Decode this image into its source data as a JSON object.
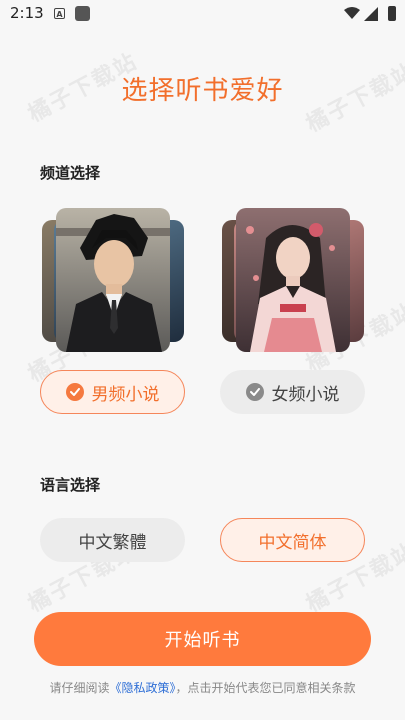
{
  "status": {
    "time": "2:13",
    "a_icon": "A"
  },
  "title": "选择听书爱好",
  "watermark": "橘子下载站",
  "channel": {
    "heading": "频道选择",
    "male": {
      "label": "男频小说",
      "selected": true
    },
    "female": {
      "label": "女频小说",
      "selected": false
    }
  },
  "language": {
    "heading": "语言选择",
    "traditional": {
      "label": "中文繁體",
      "selected": false
    },
    "simplified": {
      "label": "中文简体",
      "selected": true
    }
  },
  "start_button": "开始听书",
  "policy": {
    "prefix": "请仔细阅读",
    "link": "《隐私政策》",
    "suffix": "，点击开始代表您已同意相关条款"
  },
  "colors": {
    "accent": "#f26f2c",
    "button": "#ff7a3d",
    "link": "#2f6fd6"
  }
}
